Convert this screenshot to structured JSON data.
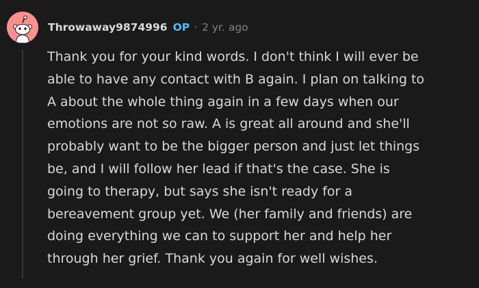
{
  "comment": {
    "author": "Throwaway9874996",
    "op_badge": "OP",
    "separator": "·",
    "timestamp": "2 yr. ago",
    "body_lines": [
      "Thank you for your kind words. I don't think I will ever be",
      "able to have any contact with B again. I plan on talking to",
      "A about the whole thing again in a few days when our",
      "emotions are not so raw. A is great all around and she'll",
      "probably want to be the bigger person and just let things",
      "be, and I will follow her lead if that's the case. She is",
      "going to therapy, but says she isn't ready for a",
      "bereavement group yet. We (her family and friends) are",
      "doing everything we can to support her and help her",
      "through her grief. Thank you again for well wishes."
    ]
  },
  "colors": {
    "background": "#1a1a1b",
    "text": "#d7dadc",
    "muted": "#818384",
    "op_badge": "#4fbcff",
    "avatar_bg": "#ff8f8f",
    "thread_line": "#343536"
  },
  "icons": {
    "avatar": "snoo-avatar-icon"
  }
}
